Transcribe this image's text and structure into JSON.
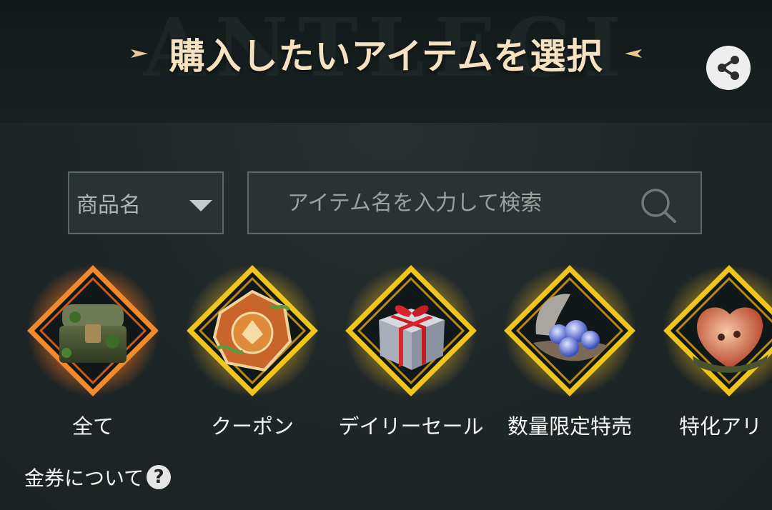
{
  "header": {
    "watermark": "ANTLEGION",
    "title": "購入したいアイテムを選択",
    "share_icon": "share-icon"
  },
  "search": {
    "select_label": "商品名",
    "placeholder": "アイテム名を入力して検索",
    "search_icon": "search-icon"
  },
  "categories": [
    {
      "label": "全て",
      "icon": "treasure-chest-icon"
    },
    {
      "label": "クーポン",
      "icon": "coupon-emblem-icon"
    },
    {
      "label": "デイリーセール",
      "icon": "gift-box-icon"
    },
    {
      "label": "数量限定特売",
      "icon": "gem-shell-icon"
    },
    {
      "label": "特化アリ",
      "icon": "amber-crystal-icon"
    }
  ],
  "footer": {
    "coupon_info": "金券について",
    "help_icon": "question-icon",
    "help_glyph": "?"
  },
  "colors": {
    "title": "#f5e2c0",
    "active_frame": "#f08a2c",
    "frame": "#f2c51c",
    "input_border": "#5b6a66"
  }
}
